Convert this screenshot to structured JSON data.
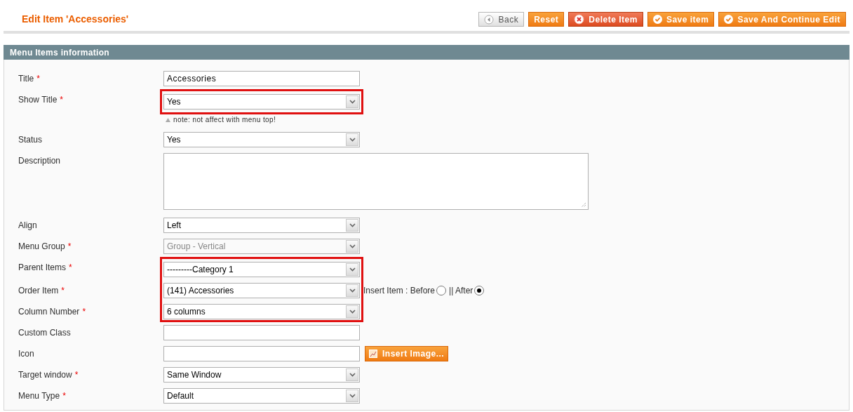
{
  "page_title": "Edit Item 'Accessories'",
  "buttons": [
    {
      "label": "Back",
      "kind": "back"
    },
    {
      "label": "Reset",
      "kind": "plain"
    },
    {
      "label": "Delete Item",
      "kind": "delete"
    },
    {
      "label": "Save item",
      "kind": "save"
    },
    {
      "label": "Save And Continue Edit",
      "kind": "save"
    }
  ],
  "section_title": "Menu Items information",
  "fields": [
    {
      "label": "Title",
      "required": "*",
      "kind": "text",
      "value": "Accessories",
      "highlighted": false
    },
    {
      "label": "Show Title",
      "required": "*",
      "kind": "select",
      "value": "Yes",
      "highlighted": true,
      "note": "note: not affect with menu top!"
    },
    {
      "label": "Status",
      "kind": "select",
      "value": "Yes",
      "highlighted": false
    },
    {
      "label": "Description",
      "kind": "textarea",
      "highlighted": false
    },
    {
      "label": "Align",
      "kind": "select",
      "value": "Left",
      "highlighted": false
    },
    {
      "label": "Menu Group",
      "required": "*",
      "kind": "select",
      "value": "Group - Vertical",
      "disabled": true,
      "highlighted": false
    },
    {
      "label": "Parent Items",
      "required": "*",
      "kind": "select",
      "value": "---------Category 1",
      "highlighted": true
    },
    {
      "label": "Order Item",
      "required": "*",
      "kind": "select",
      "value": "(141) Accessories",
      "highlighted": true,
      "radios": [
        {
          "label": "Insert Item : Before",
          "selected": false
        },
        {
          "label": "|| After",
          "selected": true
        }
      ]
    },
    {
      "label": "Column Number",
      "required": "*",
      "kind": "select",
      "value": "6 columns",
      "highlighted": true
    },
    {
      "label": "Custom Class",
      "kind": "text",
      "highlighted": false
    },
    {
      "label": "Icon",
      "kind": "text",
      "highlighted": false,
      "button": "Insert Image..."
    },
    {
      "label": "Target window",
      "required": "*",
      "kind": "select",
      "value": "Same Window",
      "highlighted": false
    },
    {
      "label": "Menu Type",
      "required": "*",
      "kind": "select",
      "value": "Default",
      "highlighted": false
    }
  ]
}
